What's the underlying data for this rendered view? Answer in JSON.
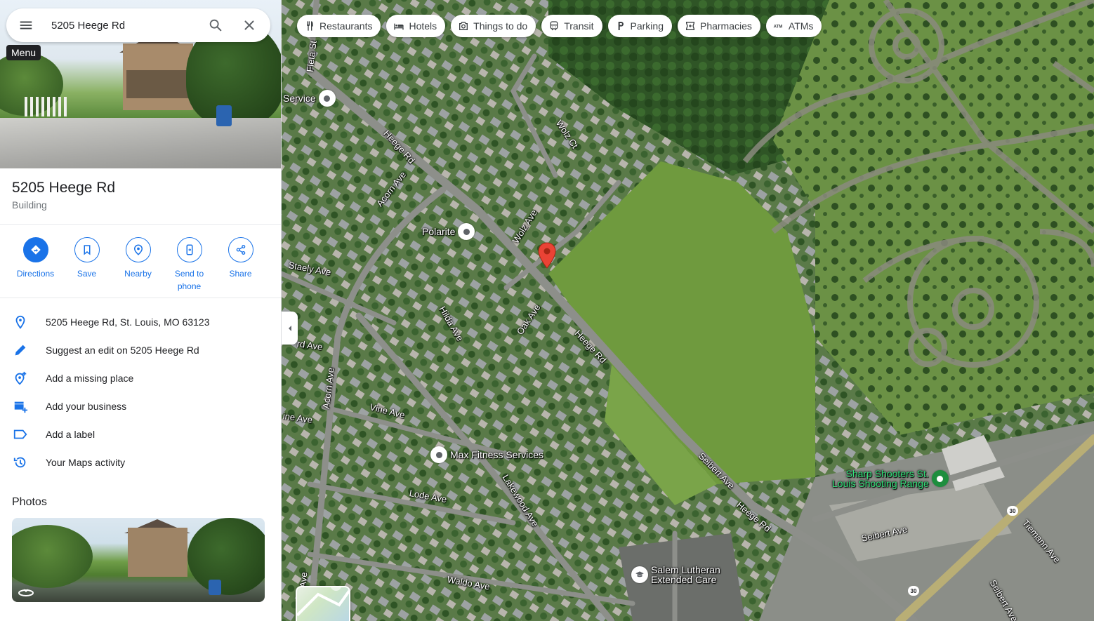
{
  "search": {
    "value": "5205 Heege Rd",
    "tooltip": "Menu"
  },
  "place": {
    "title": "5205 Heege Rd",
    "type": "Building"
  },
  "actions": [
    {
      "label": "Directions",
      "icon": "directions-icon"
    },
    {
      "label": "Save",
      "icon": "bookmark-icon"
    },
    {
      "label": "Nearby",
      "icon": "nearby-icon"
    },
    {
      "label": "Send to phone",
      "icon": "send-to-phone-icon"
    },
    {
      "label": "Share",
      "icon": "share-icon"
    }
  ],
  "info": [
    {
      "text": "5205 Heege Rd, St. Louis, MO 63123",
      "icon": "location-pin-icon"
    },
    {
      "text": "Suggest an edit on 5205 Heege Rd",
      "icon": "pencil-icon"
    },
    {
      "text": "Add a missing place",
      "icon": "add-location-icon"
    },
    {
      "text": "Add your business",
      "icon": "add-business-icon"
    },
    {
      "text": "Add a label",
      "icon": "label-icon"
    },
    {
      "text": "Your Maps activity",
      "icon": "history-icon"
    }
  ],
  "photos": {
    "heading": "Photos"
  },
  "chips": [
    {
      "label": "Restaurants",
      "icon": "fork-knife-icon"
    },
    {
      "label": "Hotels",
      "icon": "bed-icon"
    },
    {
      "label": "Things to do",
      "icon": "camera-icon"
    },
    {
      "label": "Transit",
      "icon": "train-icon"
    },
    {
      "label": "Parking",
      "icon": "parking-icon"
    },
    {
      "label": "Pharmacies",
      "icon": "pharmacy-icon"
    },
    {
      "label": "ATMs",
      "icon": "atm-icon"
    }
  ],
  "map": {
    "streets": {
      "fleta": "Fleta St",
      "heege1": "Heege Rd",
      "heege2": "Heege Rd",
      "heege3": "Heege Rd",
      "acorn1": "Acorn Ave",
      "acorn2": "Acorn Ave",
      "wolz_ct": "Wolz Ct",
      "wolz_ave": "Wolz Ave",
      "staely": "Staely Ave",
      "hilda": "Hilda Ave",
      "oak": "Oak Ave",
      "ard": "rd Ave",
      "vine": "Vine Ave",
      "ine": "ine Ave",
      "lode": "Lode Ave",
      "lakewood": "Lakewood Ave",
      "waldo": "Waldo Ave",
      "seibert1": "Seibert Ave",
      "seibert2": "Seibert Ave",
      "seibert3": "Seibert Ave",
      "tiemann": "Tiemann Ave",
      "ave_bottom": "Ave"
    },
    "pois": {
      "service": "Service",
      "polarite": "Polarite",
      "max_fitness": "Max Fitness Services",
      "sharp_line1": "Sharp Shooters St.",
      "sharp_line2": "Louis Shooting Range",
      "salem_line1": "Salem Lutheran",
      "salem_line2": "Extended Care"
    },
    "route_shields": [
      "30",
      "30"
    ]
  }
}
